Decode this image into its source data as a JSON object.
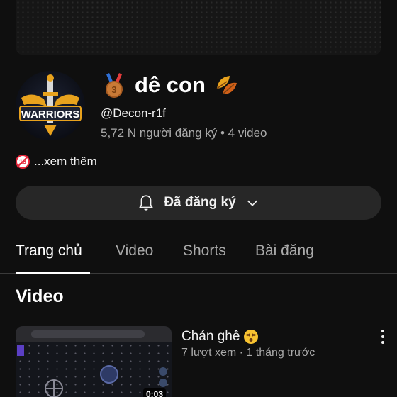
{
  "channel": {
    "name": "dê con",
    "handle": "@Decon-r1f",
    "stats": "5,72 N người đăng ký • 4 video",
    "avatar_text": "WARRIORS",
    "description": "...xem thêm"
  },
  "subscribe_button": {
    "label": "Đã đăng ký"
  },
  "tabs": [
    {
      "label": "Trang chủ"
    },
    {
      "label": "Video"
    },
    {
      "label": "Shorts"
    },
    {
      "label": "Bài đăng"
    }
  ],
  "section": {
    "title": "Video"
  },
  "video": {
    "title": "Chán ghê",
    "meta": "7 lượt xem · 1 tháng trước",
    "duration": "0:03"
  },
  "icons": [
    "medal-icon",
    "autumn-leaf-icon",
    "age-restricted-icon",
    "bell-icon",
    "chevron-down-icon",
    "dizzy-face-icon",
    "more-vertical-icon"
  ]
}
